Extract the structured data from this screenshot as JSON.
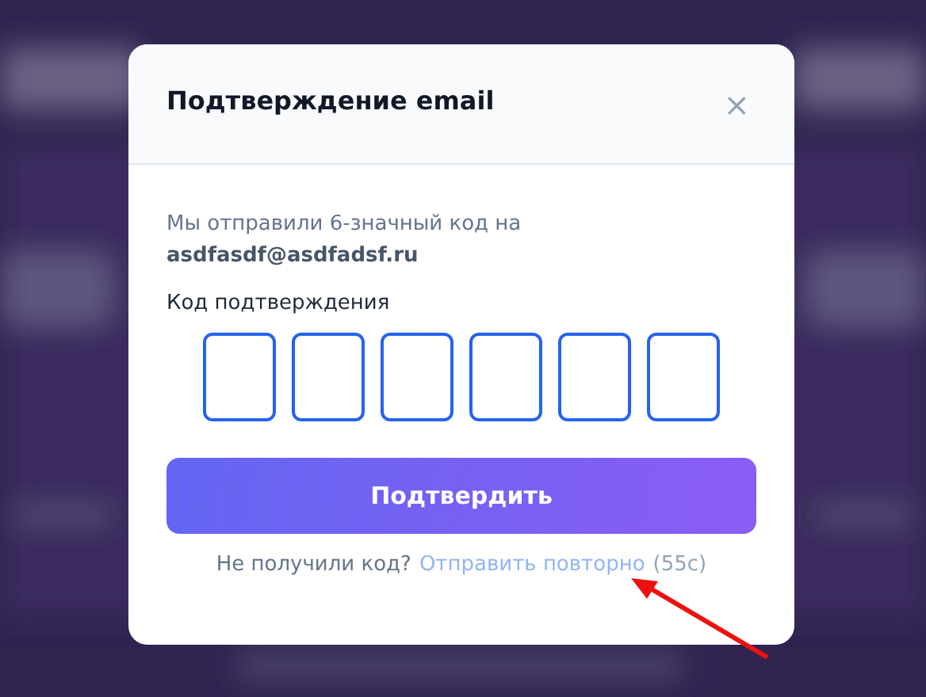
{
  "dialog": {
    "title": "Подтверждение email",
    "close_icon": "×",
    "message": "Мы отправили 6-значный код на",
    "email": "asdfasdf@asdfadsf.ru",
    "code_label": "Код подтверждения",
    "code_inputs": [
      {
        "filled": false
      },
      {
        "filled": false
      },
      {
        "filled": false
      },
      {
        "filled": false
      },
      {
        "filled": false
      },
      {
        "filled": false
      }
    ],
    "confirm_button": "Подтвердить",
    "resend": {
      "prompt": "Не получили код?",
      "link": "Отправить повторно",
      "disabled": true,
      "countdown": "(55с)"
    }
  },
  "annotation": {
    "kind": "arrow"
  }
}
